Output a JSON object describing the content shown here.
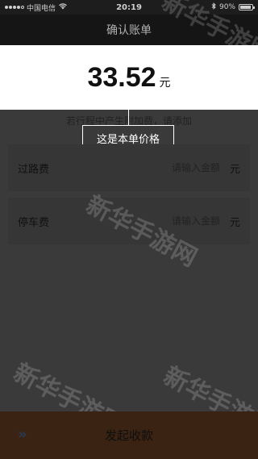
{
  "status_bar": {
    "carrier": "中国电信",
    "time": "20:19",
    "battery": "90%",
    "battery_level": 0.9
  },
  "nav": {
    "title": "确认账单"
  },
  "amount": {
    "value": "33.52",
    "unit": "元"
  },
  "hint": "若行程中产生附加费，请添加",
  "tooltip": "这是本单价格",
  "fees": [
    {
      "label": "过路费",
      "placeholder": "请输入金额",
      "unit": "元"
    },
    {
      "label": "停车费",
      "placeholder": "请输入金额",
      "unit": "元"
    }
  ],
  "bottom": {
    "button_label": "发起收款",
    "chevron": "»"
  },
  "watermark": "新华手游网",
  "colors": {
    "overlay": "#3a3a3a",
    "bottom_bar": "#3a2312",
    "nav_bar": "#151515"
  }
}
